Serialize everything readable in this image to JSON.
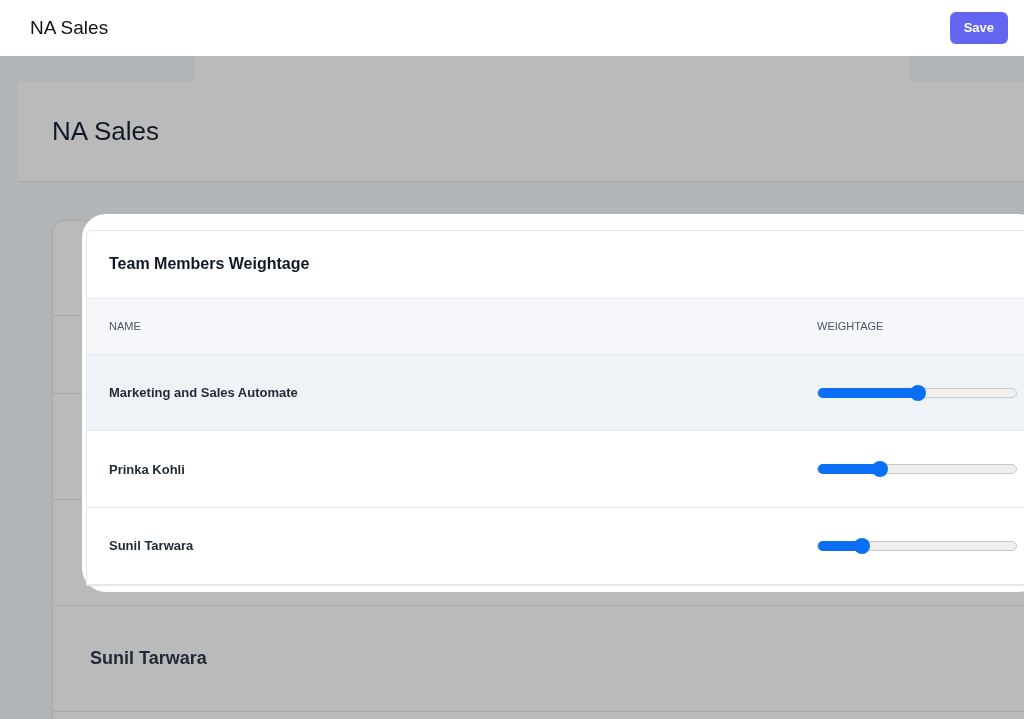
{
  "topbar": {
    "title": "NA Sales",
    "save_button": "Save"
  },
  "page": {
    "heading": "NA Sales",
    "background_row": "Sunil Tarwara"
  },
  "weightage_card": {
    "title": "Team Members Weightage",
    "columns": [
      "NAME",
      "WEIGHTAGE"
    ],
    "rows": [
      {
        "name": "Marketing and Sales Automate",
        "level": 0.5,
        "selected": true
      },
      {
        "name": "Prinka Kohli",
        "level": 0.31,
        "selected": false
      },
      {
        "name": "Sunil Tarwara",
        "level": 0.22,
        "selected": false
      }
    ]
  }
}
